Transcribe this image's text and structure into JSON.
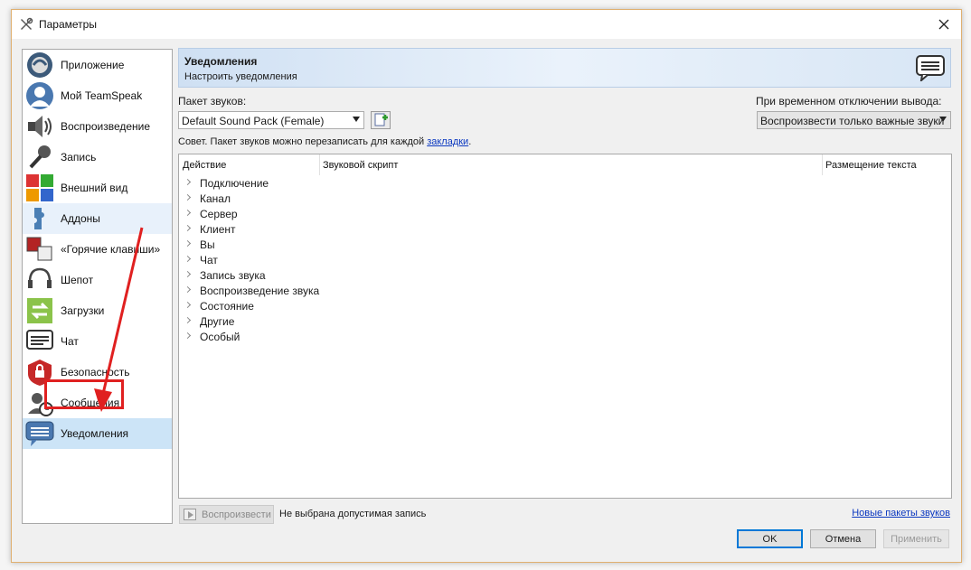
{
  "window": {
    "title": "Параметры"
  },
  "sidebar": {
    "items": [
      {
        "label": "Приложение",
        "icon": "teamspeak-logo-icon"
      },
      {
        "label": "Мой TeamSpeak",
        "icon": "user-avatar-icon"
      },
      {
        "label": "Воспроизведение",
        "icon": "speaker-icon"
      },
      {
        "label": "Запись",
        "icon": "microphone-icon"
      },
      {
        "label": "Внешний вид",
        "icon": "color-palette-icon"
      },
      {
        "label": "Аддоны",
        "icon": "puzzle-piece-icon"
      },
      {
        "label": "«Горячие клавиши»",
        "icon": "hotkeys-icon"
      },
      {
        "label": "Шепот",
        "icon": "headset-icon"
      },
      {
        "label": "Загрузки",
        "icon": "transfer-icon"
      },
      {
        "label": "Чат",
        "icon": "chat-icon"
      },
      {
        "label": "Безопасность",
        "icon": "lock-icon"
      },
      {
        "label": "Сообщения",
        "icon": "messages-clock-icon"
      },
      {
        "label": "Уведомления",
        "icon": "notifications-icon"
      }
    ],
    "hover_index": 5,
    "selected_index": 12
  },
  "header": {
    "title": "Уведомления",
    "subtitle": "Настроить уведомления"
  },
  "sound_pack": {
    "label": "Пакет звуков:",
    "value": "Default Sound Pack (Female)"
  },
  "mute_output": {
    "label": "При временном отключении вывода:",
    "value": "Воспроизвести только важные звуки"
  },
  "tip": {
    "text": "Совет. Пакет звуков можно перезаписать для каждой ",
    "link": "закладки",
    "end": "."
  },
  "table": {
    "columns": [
      "Действие",
      "Звуковой скрипт",
      "Размещение текста"
    ],
    "rows": [
      "Подключение",
      "Канал",
      "Сервер",
      "Клиент",
      "Вы",
      "Чат",
      "Запись звука",
      "Воспроизведение звука",
      "Состояние",
      "Другие",
      "Особый"
    ]
  },
  "bottom": {
    "play_label": "Воспроизвести",
    "status": "Не выбрана допустимая запись",
    "new_packs_link": "Новые пакеты звуков"
  },
  "buttons": {
    "ok": "OK",
    "cancel": "Отмена",
    "apply": "Применить"
  },
  "colors": {
    "annotation_red": "#e02020",
    "selection_blue": "#cce4f7",
    "link_blue": "#0b38c0"
  }
}
